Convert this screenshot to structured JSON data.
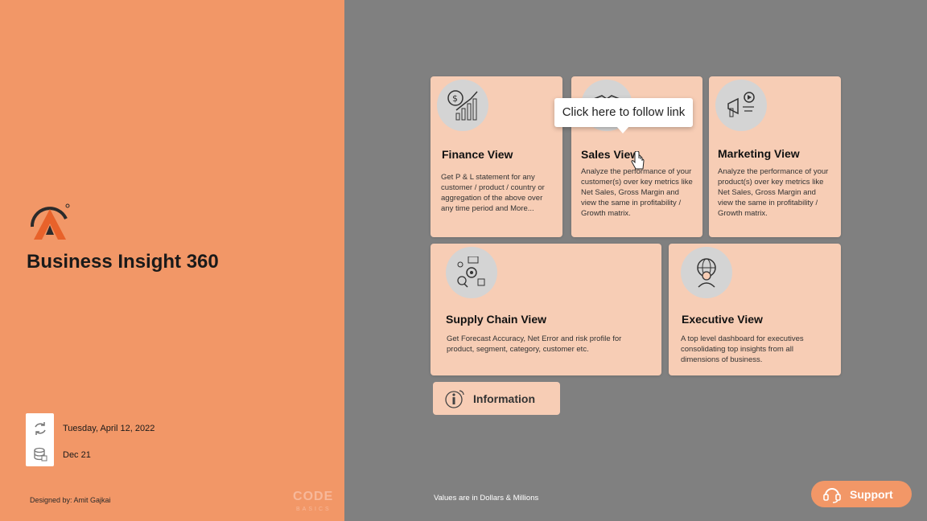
{
  "app": {
    "title": "Business Insight 360",
    "refresh_date": "Tuesday, April 12, 2022",
    "data_through": "Dec 21",
    "designed_by": "Designed by: Amit Gajkai",
    "brand_top": "ODE",
    "brand_bottom": "BASICS"
  },
  "cards": [
    {
      "title": "Finance View",
      "description": "Get P & L statement for any customer / product / country or aggregation of the above over any time period and More...",
      "icon": "finance-chart-icon"
    },
    {
      "title": "Sales View",
      "description": "Analyze the performance of your customer(s) over key metrics like Net Sales, Gross Margin and view the same in profitability / Growth matrix.",
      "icon": "sales-handshake-icon"
    },
    {
      "title": "Marketing View",
      "description": "Analyze the performance of your product(s) over key metrics like Net Sales, Gross Margin and view the same in profitability / Growth matrix.",
      "icon": "marketing-megaphone-icon"
    },
    {
      "title": "Supply Chain View",
      "description": "Get Forecast Accuracy, Net Error and risk profile for product, segment, category, customer etc.",
      "icon": "supply-chain-icon"
    },
    {
      "title": "Executive View",
      "description": "A top level dashboard for executives consolidating top insights from all dimensions of business.",
      "icon": "executive-globe-icon"
    }
  ],
  "tooltip": "Click here to follow link",
  "information_label": "Information",
  "support_label": "Support",
  "footnote": "Values are in Dollars & Millions",
  "colors": {
    "left_panel": "#f29767",
    "right_panel": "#808080",
    "card": "#f7cdb5",
    "support": "#f29767"
  }
}
